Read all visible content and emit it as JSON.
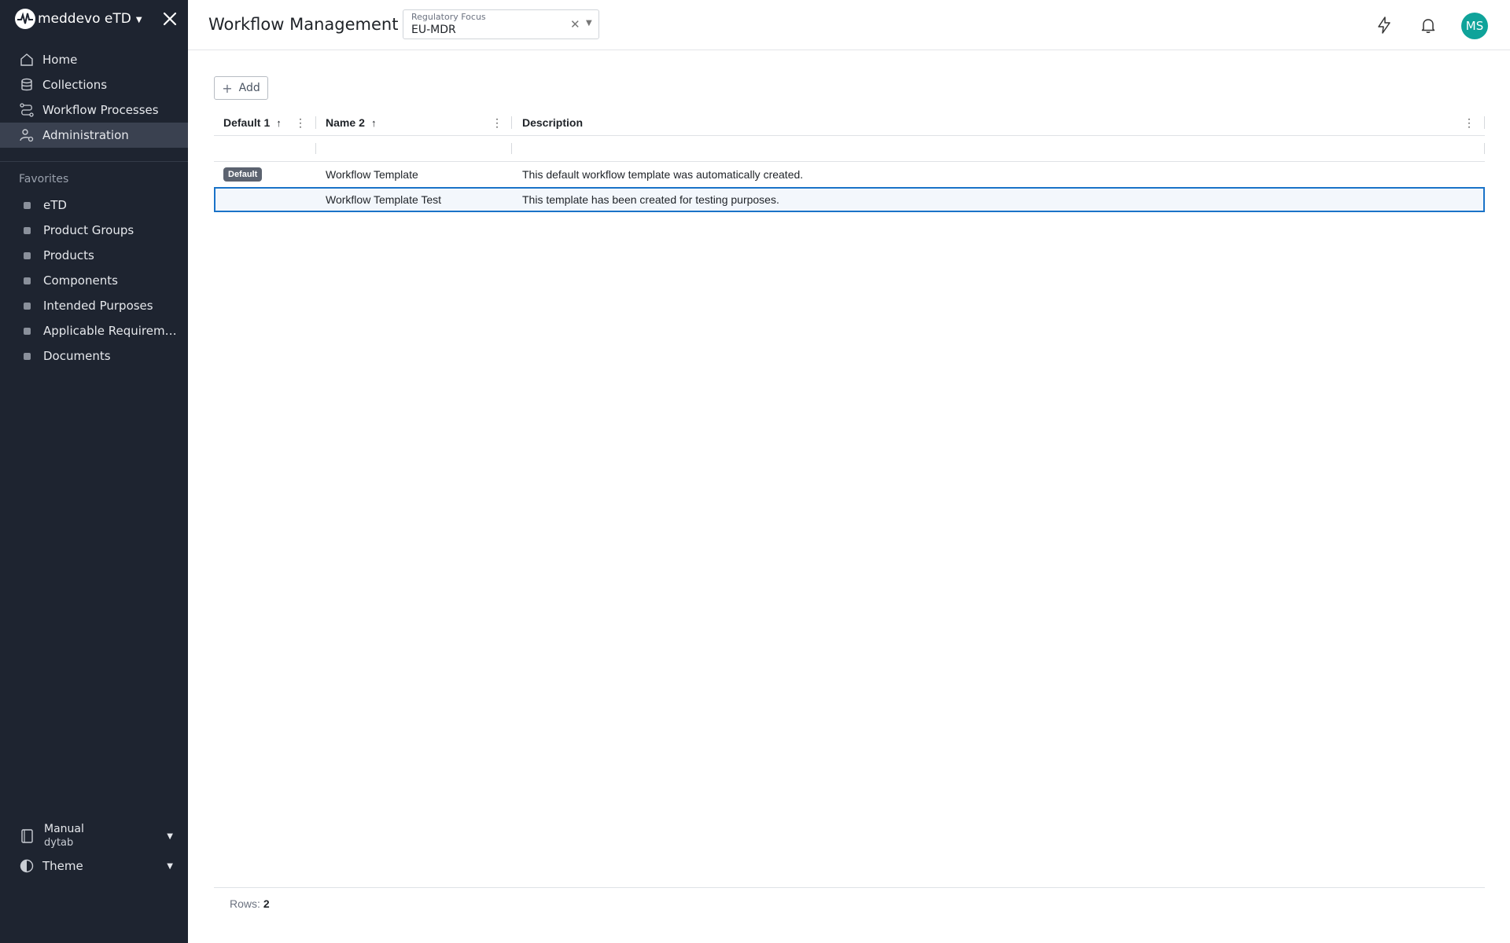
{
  "sidebar": {
    "brand": "meddevo eTD",
    "nav": [
      {
        "label": "Home",
        "icon": "home-icon"
      },
      {
        "label": "Collections",
        "icon": "database-icon"
      },
      {
        "label": "Workflow Processes",
        "icon": "workflow-icon"
      },
      {
        "label": "Administration",
        "icon": "user-settings-icon",
        "active": true
      }
    ],
    "favorites_title": "Favorites",
    "favorites": [
      "eTD",
      "Product Groups",
      "Products",
      "Components",
      "Intended Purposes",
      "Applicable Requirements",
      "Documents"
    ],
    "manual": {
      "title": "Manual",
      "subtitle": "dytab"
    },
    "theme_label": "Theme"
  },
  "header": {
    "title": "Workflow Management",
    "regulatory_focus": {
      "label": "Regulatory Focus",
      "value": "EU-MDR"
    },
    "avatar_initials": "MS",
    "avatar_color": "#0fa39a"
  },
  "toolbar": {
    "add_label": "Add"
  },
  "grid": {
    "columns": [
      {
        "label": "Default",
        "sort_order": "1"
      },
      {
        "label": "Name",
        "sort_order": "2"
      },
      {
        "label": "Description",
        "sort_order": ""
      }
    ],
    "rows": [
      {
        "default_badge": "Default",
        "name": "Workflow Template",
        "description": "This default workflow template was automatically created."
      },
      {
        "default_badge": "",
        "name": "Workflow Template Test",
        "description": "This template has been created for testing purposes.",
        "selected": true
      }
    ]
  },
  "footer": {
    "rows_label": "Rows:",
    "rows_count": "2"
  },
  "colors": {
    "sidebar_bg": "#1e2430",
    "selection_border": "#1a73c8",
    "accent": "#0fa39a"
  }
}
